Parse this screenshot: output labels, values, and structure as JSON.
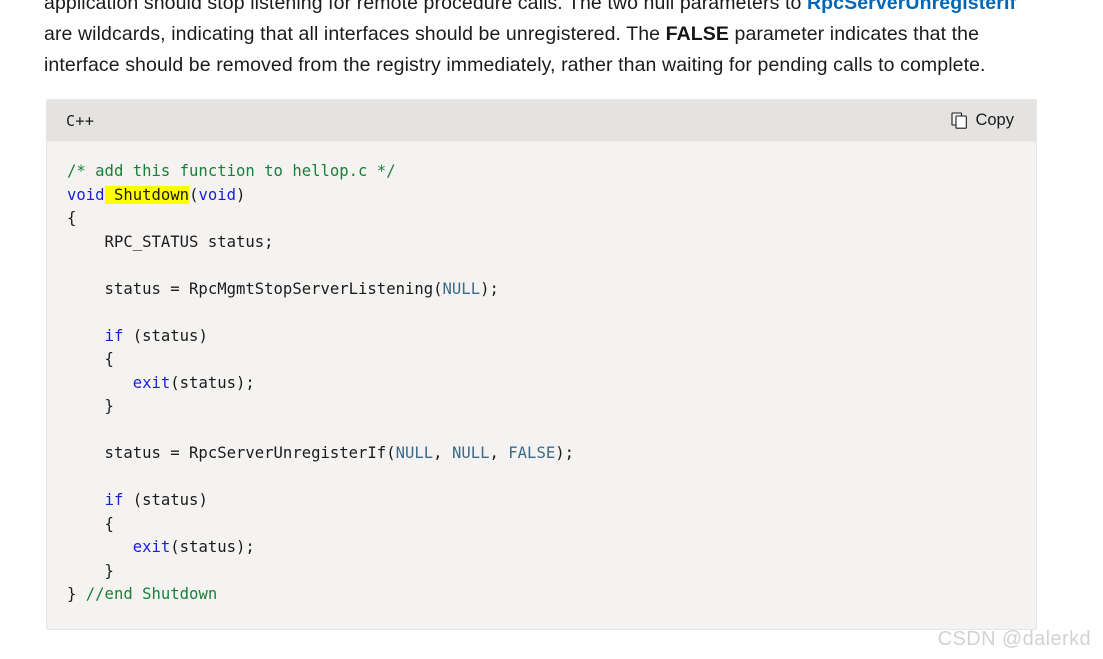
{
  "prose": {
    "line1_pre": "application should stop listening for remote procedure calls. The two null parameters to ",
    "line1_link": "RpcServerUnregisterIf",
    "line2_pre": "are wildcards, indicating that all interfaces should be unregistered. The ",
    "line2_bold": "FALSE",
    "line2_post": " parameter indicates that the",
    "line3": "interface should be removed from the registry immediately, rather than waiting for pending calls to complete."
  },
  "code_block": {
    "language_label": "C++",
    "copy_label": "Copy",
    "copy_icon": "copy-icon",
    "lines": [
      {
        "tokens": [
          {
            "t": "/* add this function to hellop.c */",
            "c": "c-comment"
          }
        ]
      },
      {
        "tokens": [
          {
            "t": "void",
            "c": "c-keyword"
          },
          {
            "t": " Shutdown",
            "c": "hl"
          },
          {
            "t": "(",
            "c": "c-plain"
          },
          {
            "t": "void",
            "c": "c-keyword"
          },
          {
            "t": ")",
            "c": "c-plain"
          }
        ]
      },
      {
        "tokens": [
          {
            "t": "{",
            "c": "c-plain"
          }
        ]
      },
      {
        "tokens": [
          {
            "t": "    RPC_STATUS status;",
            "c": "c-plain"
          }
        ]
      },
      {
        "tokens": [
          {
            "t": "",
            "c": "c-plain"
          }
        ]
      },
      {
        "tokens": [
          {
            "t": "    status = RpcMgmtStopServerListening(",
            "c": "c-plain"
          },
          {
            "t": "NULL",
            "c": "c-const"
          },
          {
            "t": ");",
            "c": "c-plain"
          }
        ]
      },
      {
        "tokens": [
          {
            "t": "",
            "c": "c-plain"
          }
        ]
      },
      {
        "tokens": [
          {
            "t": "    ",
            "c": "c-plain"
          },
          {
            "t": "if",
            "c": "c-keyword"
          },
          {
            "t": " (status)",
            "c": "c-plain"
          }
        ]
      },
      {
        "tokens": [
          {
            "t": "    {",
            "c": "c-plain"
          }
        ]
      },
      {
        "tokens": [
          {
            "t": "       ",
            "c": "c-plain"
          },
          {
            "t": "exit",
            "c": "c-fn"
          },
          {
            "t": "(status);",
            "c": "c-plain"
          }
        ]
      },
      {
        "tokens": [
          {
            "t": "    }",
            "c": "c-plain"
          }
        ]
      },
      {
        "tokens": [
          {
            "t": "",
            "c": "c-plain"
          }
        ]
      },
      {
        "tokens": [
          {
            "t": "    status = RpcServerUnregisterIf(",
            "c": "c-plain"
          },
          {
            "t": "NULL",
            "c": "c-const"
          },
          {
            "t": ", ",
            "c": "c-plain"
          },
          {
            "t": "NULL",
            "c": "c-const"
          },
          {
            "t": ", ",
            "c": "c-plain"
          },
          {
            "t": "FALSE",
            "c": "c-const"
          },
          {
            "t": ");",
            "c": "c-plain"
          }
        ]
      },
      {
        "tokens": [
          {
            "t": "",
            "c": "c-plain"
          }
        ]
      },
      {
        "tokens": [
          {
            "t": "    ",
            "c": "c-plain"
          },
          {
            "t": "if",
            "c": "c-keyword"
          },
          {
            "t": " (status)",
            "c": "c-plain"
          }
        ]
      },
      {
        "tokens": [
          {
            "t": "    {",
            "c": "c-plain"
          }
        ]
      },
      {
        "tokens": [
          {
            "t": "       ",
            "c": "c-plain"
          },
          {
            "t": "exit",
            "c": "c-fn"
          },
          {
            "t": "(status);",
            "c": "c-plain"
          }
        ]
      },
      {
        "tokens": [
          {
            "t": "    }",
            "c": "c-plain"
          }
        ]
      },
      {
        "tokens": [
          {
            "t": "} ",
            "c": "c-plain"
          },
          {
            "t": "//end Shutdown",
            "c": "c-comment"
          }
        ]
      }
    ]
  },
  "watermark": {
    "text": "CSDN @dalerkd"
  },
  "colors": {
    "link": "#0067b8",
    "comment": "#1a7f37",
    "keyword": "#1921d6",
    "constant": "#3d6a85",
    "highlight": "#ffff00",
    "code_bg": "#f4f3f2",
    "header_bg": "#e4e3e2",
    "watermark": "#d2d2d2"
  }
}
